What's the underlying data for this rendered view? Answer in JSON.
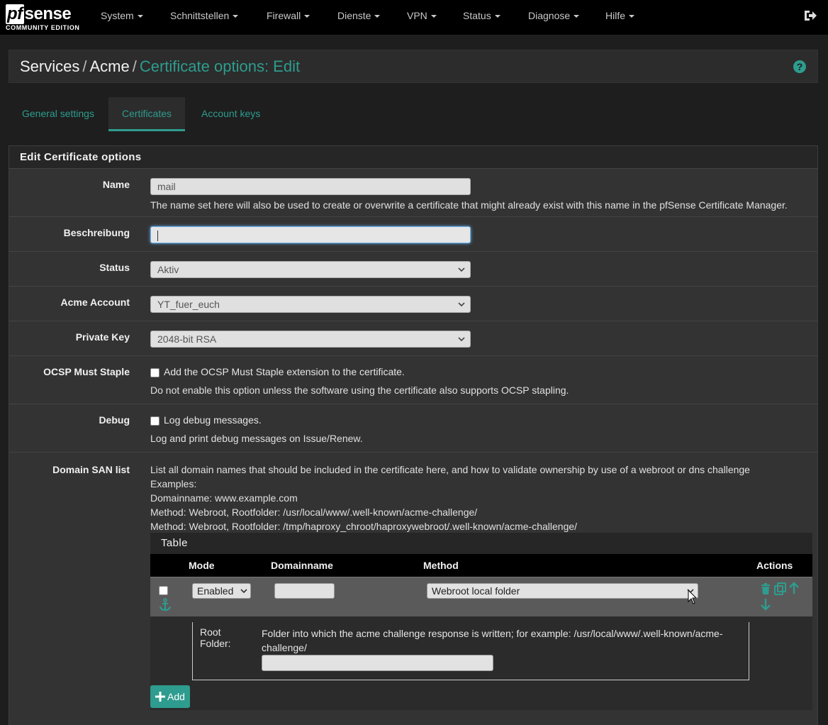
{
  "brand": {
    "name": "sense",
    "prefix": "pf",
    "edition": "COMMUNITY EDITION"
  },
  "nav": {
    "items": [
      "System",
      "Schnittstellen",
      "Firewall",
      "Dienste",
      "VPN",
      "Status",
      "Diagnose",
      "Hilfe"
    ]
  },
  "breadcrumb": {
    "part1": "Services",
    "part2": "Acme",
    "active": "Certificate options: Edit"
  },
  "tabs": [
    "General settings",
    "Certificates",
    "Account keys"
  ],
  "panel": {
    "title": "Edit Certificate options"
  },
  "form": {
    "name": {
      "label": "Name",
      "value": "mail",
      "help": "The name set here will also be used to create or overwrite a certificate that might already exist with this name in the pfSense Certificate Manager."
    },
    "description": {
      "label": "Beschreibung",
      "value": ""
    },
    "status": {
      "label": "Status",
      "value": "Aktiv"
    },
    "account": {
      "label": "Acme Account",
      "value": "YT_fuer_euch"
    },
    "private_key": {
      "label": "Private Key",
      "value": "2048-bit RSA"
    },
    "ocsp": {
      "label": "OCSP Must Staple",
      "checkbox_text": "Add the OCSP Must Staple extension to the certificate.",
      "help": "Do not enable this option unless the software using the certificate also supports OCSP stapling."
    },
    "debug": {
      "label": "Debug",
      "checkbox_text": "Log debug messages.",
      "help": "Log and print debug messages on Issue/Renew."
    },
    "san": {
      "label": "Domain SAN list",
      "help_lines": [
        "List all domain names that should be included in the certificate here, and how to validate ownership by use of a webroot or dns challenge",
        "Examples:",
        "Domainname: www.example.com",
        "Method: Webroot, Rootfolder: /usr/local/www/.well-known/acme-challenge/",
        "Method: Webroot, Rootfolder: /tmp/haproxy_chroot/haproxywebroot/.well-known/acme-challenge/"
      ],
      "table_title": "Table",
      "columns": {
        "mode": "Mode",
        "domainname": "Domainname",
        "method": "Method",
        "actions": "Actions"
      },
      "row": {
        "mode": "Enabled",
        "domainname": "",
        "method": "Webroot local folder"
      },
      "root_folder": {
        "label_line1": "Root",
        "label_line2": "Folder:",
        "help_line1": "Folder into which the acme challenge response is written; for example: /usr/local/www/.well-known/acme-",
        "help_line2": "challenge/",
        "value": ""
      },
      "add_label": "Add"
    }
  },
  "colors": {
    "accent": "#2e9c8e",
    "background": "#1e1e1e",
    "panel": "#333333"
  }
}
